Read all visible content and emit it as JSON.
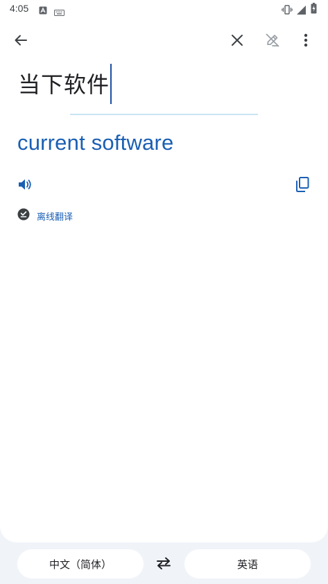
{
  "status_bar": {
    "time": "4:05",
    "icons": [
      "a-badge-icon",
      "keyboard-icon",
      "vibrate-icon",
      "signal-icon",
      "battery-charging-icon"
    ]
  },
  "toolbar": {
    "back_icon": "arrow-back-icon",
    "clear_icon": "close-icon",
    "handwrite_icon": "pen-off-icon",
    "menu_icon": "more-vert-icon"
  },
  "input": {
    "source_text": "当下软件"
  },
  "result": {
    "translation": "current software",
    "speak_icon": "volume-icon",
    "copy_icon": "copy-icon",
    "offline_label": "离线翻译",
    "offline_icon": "check-download-icon"
  },
  "languages": {
    "source": "中文（简体）",
    "target": "英语",
    "swap_icon": "swap-icon"
  },
  "colors": {
    "accent": "#1a5fb4",
    "background": "#f0f4f9"
  }
}
